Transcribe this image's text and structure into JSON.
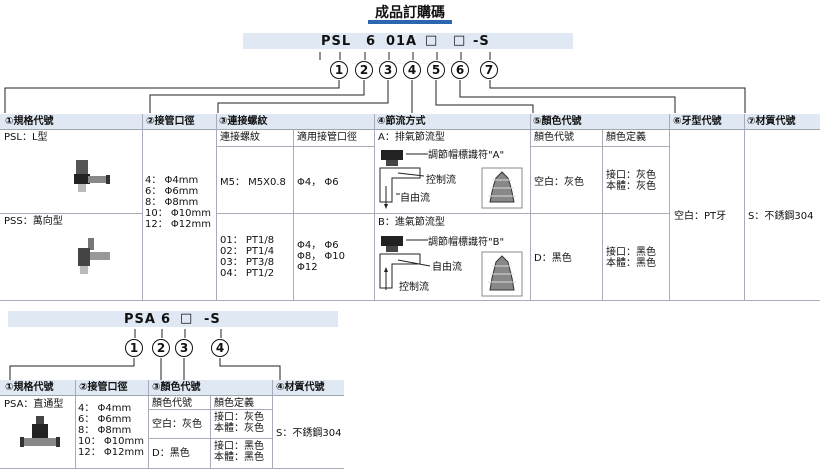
{
  "title": "成品訂購碼",
  "psl_code": {
    "parts": [
      "PSL",
      "6",
      "01",
      "A",
      "□",
      "□",
      "-S"
    ],
    "markers": [
      "1",
      "2",
      "3",
      "4",
      "5",
      "6",
      "7"
    ]
  },
  "psl_table": {
    "headers": [
      "①規格代號",
      "②接管口徑",
      "③連接螺紋",
      "④節流方式",
      "⑤顏色代號",
      "⑥牙型代號",
      "⑦材質代號"
    ],
    "spec": {
      "row1": "PSL：L型",
      "row2": "PSS：萬向型"
    },
    "tube_sizes": "4： Φ4mm\n6： Φ6mm\n8： Φ8mm\n10： Φ10mm\n12： Φ12mm",
    "thread_sub_headers": [
      "連接螺紋",
      "適用接管口徑"
    ],
    "thread_row1": {
      "thread": "M5： M5X0.8",
      "tube": "Φ4， Φ6"
    },
    "thread_row2": {
      "thread": "01： PT1/8\n02： PT1/4\n03： PT3/8\n04： PT1/2",
      "tube": "Φ4， Φ6\nΦ8， Φ10\nΦ12"
    },
    "flow_a": {
      "label": "A：排氣節流型",
      "adjust": "調節帽標識符\"A\"",
      "control": "控制流",
      "free": "自由流"
    },
    "flow_b": {
      "label": "B：進氣節流型",
      "adjust": "調節帽標識符\"B\"",
      "free": "自由流",
      "control": "控制流"
    },
    "color_sub_headers": [
      "顏色代號",
      "顏色定義"
    ],
    "color_row1": {
      "code": "空白：灰色",
      "def": "接口：灰色\n本體：灰色"
    },
    "color_row2": {
      "code": "D：黑色",
      "def": "接口：黑色\n本體：黑色"
    },
    "thread_type": "空白：PT牙",
    "material": "S：不銹鋼304"
  },
  "psa_code": {
    "parts": [
      "PSA",
      "6",
      "□",
      "-S"
    ],
    "markers": [
      "1",
      "2",
      "3",
      "4"
    ]
  },
  "psa_table": {
    "headers": [
      "①規格代號",
      "②接管口徑",
      "③顏色代號",
      "④材質代號"
    ],
    "spec": "PSA：直通型",
    "tube_sizes": "4： Φ4mm\n6： Φ6mm\n8： Φ8mm\n10： Φ10mm\n12： Φ12mm",
    "color_sub_headers": [
      "顏色代號",
      "顏色定義"
    ],
    "color_row1": {
      "code": "空白：灰色",
      "def": "接口：灰色\n本體：灰色"
    },
    "color_row2": {
      "code": "D：黑色",
      "def": "接口：黑色\n本體：黑色"
    },
    "material": "S：不銹鋼304"
  },
  "colors": {
    "accent": "#2b66b0",
    "header_bg": "#dfe8f3"
  }
}
